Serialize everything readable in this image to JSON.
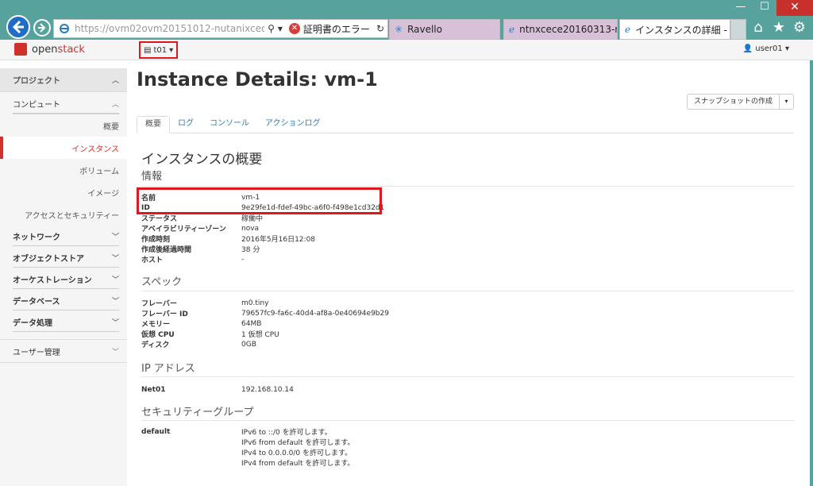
{
  "browser": {
    "url": "https://ovm02ovm20151012-nutanixceovmde...",
    "cert_error": "証明書のエラー",
    "tabs": [
      {
        "label": "Ravello"
      },
      {
        "label": "ntnxcece20160313-n..."
      },
      {
        "label": "インスタンスの詳細 - ..."
      }
    ],
    "window_buttons": {
      "minimize": "—",
      "maximize": "☐",
      "close": "✕"
    }
  },
  "header": {
    "logo_open": "open",
    "logo_stack": "stack",
    "project": "t01",
    "user": "user01"
  },
  "sidebar": {
    "project": "プロジェクト",
    "compute": "コンピュート",
    "compute_items": [
      "概要",
      "インスタンス",
      "ボリューム",
      "イメージ",
      "アクセスとセキュリティー"
    ],
    "groups": [
      "ネットワーク",
      "オブジェクトストア",
      "オーケストレーション",
      "データベース",
      "データ処理"
    ],
    "admin": "ユーザー管理"
  },
  "main": {
    "title": "Instance Details: vm-1",
    "snapshot_button": "スナップショットの作成",
    "tabs": [
      "概要",
      "ログ",
      "コンソール",
      "アクションログ"
    ],
    "overview_title": "インスタンスの概要",
    "info_title": "情報",
    "info": [
      {
        "k": "名前",
        "v": "vm-1"
      },
      {
        "k": "ID",
        "v": "9e29fe1d-fdef-49bc-a6f0-f498e1cd32d1"
      },
      {
        "k": "ステータス",
        "v": "稼働中"
      },
      {
        "k": "アベイラビリティーゾーン",
        "v": "nova"
      },
      {
        "k": "作成時刻",
        "v": "2016年5月16日12:08"
      },
      {
        "k": "作成後経過時間",
        "v": "38 分"
      },
      {
        "k": "ホスト",
        "v": "-"
      }
    ],
    "spec_title": "スペック",
    "spec": [
      {
        "k": "フレーバー",
        "v": "m0.tiny"
      },
      {
        "k": "フレーバー ID",
        "v": "79657fc9-fa6c-40d4-af8a-0e40694e9b29"
      },
      {
        "k": "メモリー",
        "v": "64MB"
      },
      {
        "k": "仮想 CPU",
        "v": "1 仮想 CPU"
      },
      {
        "k": "ディスク",
        "v": "0GB"
      }
    ],
    "ip_title": "IP アドレス",
    "ip": {
      "k": "Net01",
      "v": "192.168.10.14"
    },
    "secgroup_title": "セキュリティーグループ",
    "secgroup": {
      "k": "default",
      "rules": [
        "IPv6 to ::/0 を許可します。",
        "IPv6 from default を許可します。",
        "IPv4 to 0.0.0.0/0 を許可します。",
        "IPv4 from default を許可します。"
      ]
    }
  }
}
